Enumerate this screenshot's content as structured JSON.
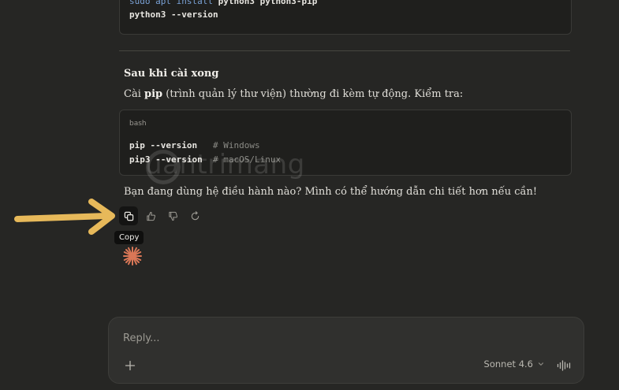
{
  "code_top": {
    "lines": [
      {
        "kw": "sudo apt install",
        "rest": " python3 python3-pip"
      },
      {
        "kw": "",
        "rest": "python3 --version"
      }
    ]
  },
  "section": {
    "heading": "Sau khi cài xong",
    "para_before": "Cài ",
    "para_bold": "pip",
    "para_after": " (trình quản lý thư viện) thường đi kèm tự động. Kiểm tra:"
  },
  "code_bash": {
    "language": "bash",
    "lines": [
      {
        "cmd": "pip --version",
        "pad": "   ",
        "comment": "# Windows"
      },
      {
        "cmd": "pip3 --version",
        "pad": "  ",
        "comment": "# macOS/Linux"
      }
    ]
  },
  "question": "Bạn đang dùng hệ điều hành nào? Mình có thể hướng dẫn chi tiết hơn nếu cần!",
  "watermark": "uantrimang",
  "actions": {
    "tooltip": "Copy",
    "icons": [
      "copy-icon",
      "thumbs-up-icon",
      "thumbs-down-icon",
      "retry-icon"
    ]
  },
  "composer": {
    "placeholder": "Reply...",
    "model": "Sonnet 4.6"
  },
  "colors": {
    "background": "#262624",
    "arrow": "#e7b95a",
    "spark": "#d97757"
  }
}
